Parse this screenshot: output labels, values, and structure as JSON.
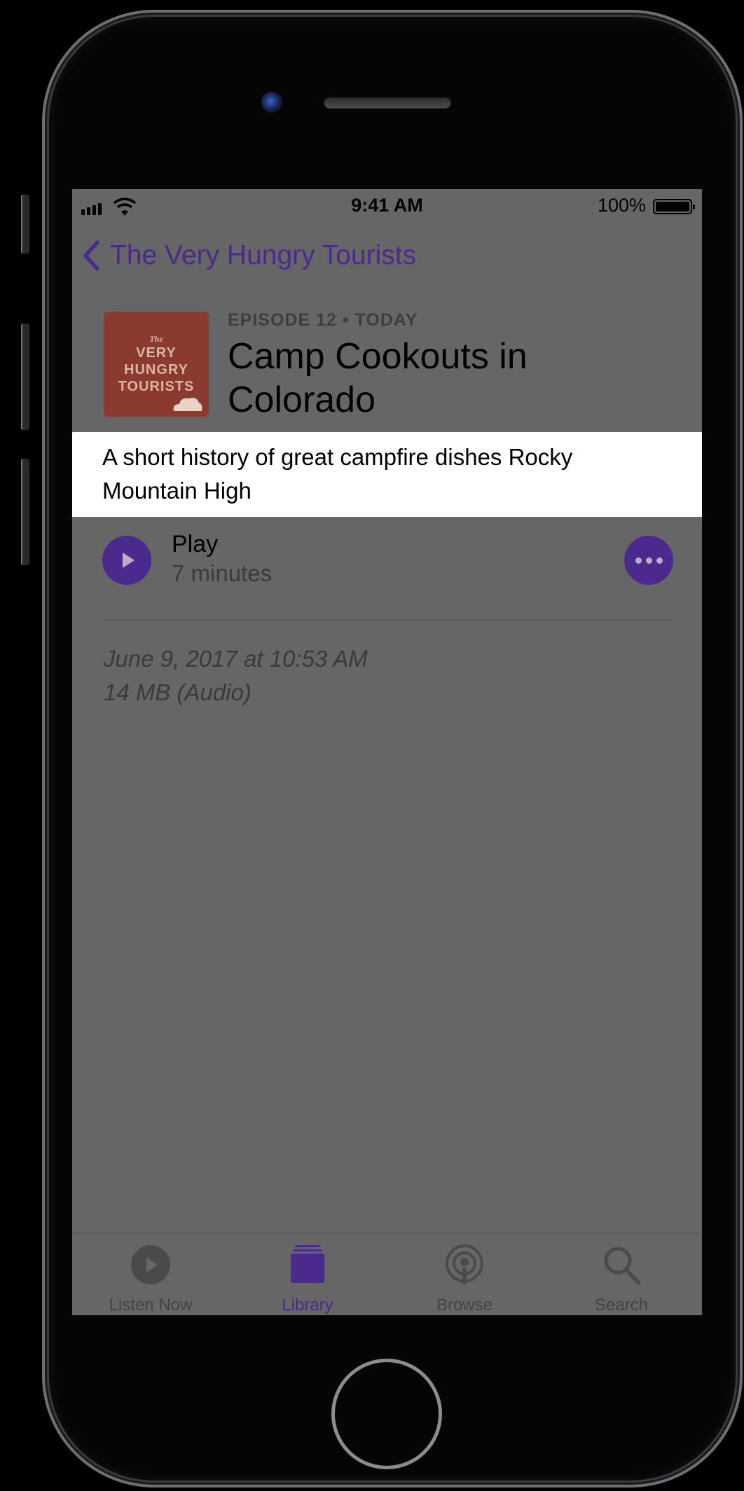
{
  "status_bar": {
    "time": "9:41 AM",
    "battery": "100%"
  },
  "nav": {
    "back_label": "The Very Hungry Tourists"
  },
  "artwork": {
    "line1": "The",
    "line2": "VERY",
    "line3": "HUNGRY",
    "line4": "TOURISTS"
  },
  "episode": {
    "meta": "EPISODE 12 • TODAY",
    "title": "Camp Cookouts in Colorado",
    "description": "A short history of great campfire dishes Rocky Mountain High"
  },
  "player": {
    "play_label": "Play",
    "duration": "7 minutes"
  },
  "details": {
    "date": "June 9, 2017 at 10:53 AM",
    "size": "14 MB (Audio)"
  },
  "tabbar": {
    "tabs": [
      {
        "label": "Listen Now",
        "icon": "play-circle-icon"
      },
      {
        "label": "Library",
        "icon": "library-stack-icon"
      },
      {
        "label": "Browse",
        "icon": "podcast-icon"
      },
      {
        "label": "Search",
        "icon": "search-icon"
      }
    ],
    "active": "Library"
  },
  "colors": {
    "accent": "#4b2a8e",
    "screen_dim": "#666666",
    "highlight": "#ffffff",
    "artwork": "#8b3a30"
  }
}
